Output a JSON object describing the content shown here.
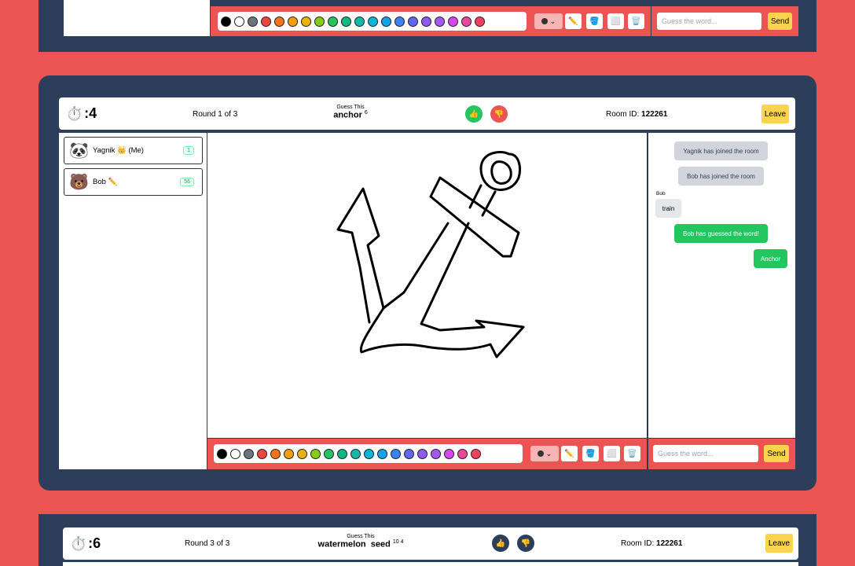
{
  "top_panel": {
    "word_placeholder": "Guess the word...",
    "send_label": "Send"
  },
  "main_panel": {
    "timer": ":4",
    "round": "Round 1 of 3",
    "guess_label": "Guess This",
    "word": "anchor",
    "word_length": "6",
    "room_label": "Room ID:",
    "room_id": "122261",
    "leave_label": "Leave",
    "players": [
      {
        "avatar": "🐼",
        "name": "Yagnik 👑 (Me)",
        "score": "1"
      },
      {
        "avatar": "🐻",
        "name": "Bob ✏️",
        "score": "56"
      }
    ],
    "chat": {
      "sys1": "Yagnik has joined the room",
      "sys2": "Bob has joined the room",
      "sender": "Bob",
      "msg": "train",
      "guessed": "Bob has guessed the word!",
      "own": "Anchor"
    },
    "word_placeholder": "Guess the word...",
    "send_label": "Send"
  },
  "bottom_panel": {
    "timer": ":6",
    "round": "Round 3 of 3",
    "guess_label": "Guess This",
    "word": "watermelon  seed",
    "word_length": "10 4",
    "room_label": "Room ID:",
    "room_id": "122261",
    "leave_label": "Leave"
  },
  "palette_colors": [
    "#000000",
    "#ffffff",
    "#6b7280",
    "#ef4444",
    "#f97316",
    "#f59e0b",
    "#eab308",
    "#84cc16",
    "#22c55e",
    "#10b981",
    "#14b8a6",
    "#06b6d4",
    "#0ea5e9",
    "#3b82f6",
    "#6366f1",
    "#8b5cf6",
    "#a855f7",
    "#d946ef",
    "#ec4899",
    "#f43f5e"
  ],
  "icons": {
    "like": "thumbs-up-icon",
    "dislike": "thumbs-down-icon",
    "pencil": "pencil-icon",
    "fill": "bucket-icon",
    "eraser": "eraser-icon",
    "trash": "trash-icon",
    "timer": "stopwatch-icon"
  }
}
